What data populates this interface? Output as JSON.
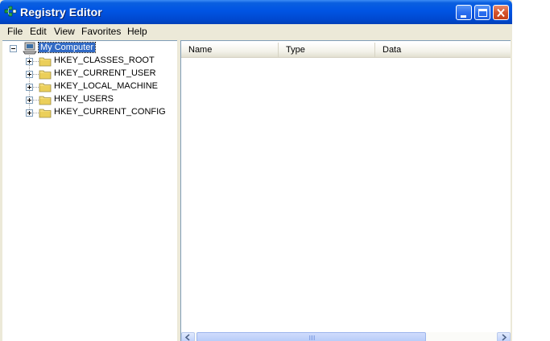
{
  "window": {
    "title": "Registry Editor",
    "controls": {
      "minimize": "minimize-icon",
      "maximize": "maximize-icon",
      "close": "close-icon"
    },
    "title_bar_color": "#0054e3"
  },
  "menu": {
    "items": [
      {
        "label": "File"
      },
      {
        "label": "Edit"
      },
      {
        "label": "View"
      },
      {
        "label": "Favorites"
      },
      {
        "label": "Help"
      }
    ]
  },
  "tree": {
    "root": {
      "label": "My Computer",
      "icon": "computer-icon",
      "expanded": true,
      "selected": true
    },
    "children": [
      {
        "label": "HKEY_CLASSES_ROOT",
        "icon": "folder-icon"
      },
      {
        "label": "HKEY_CURRENT_USER",
        "icon": "folder-icon"
      },
      {
        "label": "HKEY_LOCAL_MACHINE",
        "icon": "folder-icon"
      },
      {
        "label": "HKEY_USERS",
        "icon": "folder-icon"
      },
      {
        "label": "HKEY_CURRENT_CONFIG",
        "icon": "folder-icon"
      }
    ]
  },
  "list": {
    "columns": [
      {
        "label": "Name"
      },
      {
        "label": "Type"
      },
      {
        "label": "Data"
      }
    ],
    "rows": []
  },
  "colors": {
    "selection": "#316ac5",
    "folder": "#e8d06a",
    "face": "#ece9d8"
  }
}
